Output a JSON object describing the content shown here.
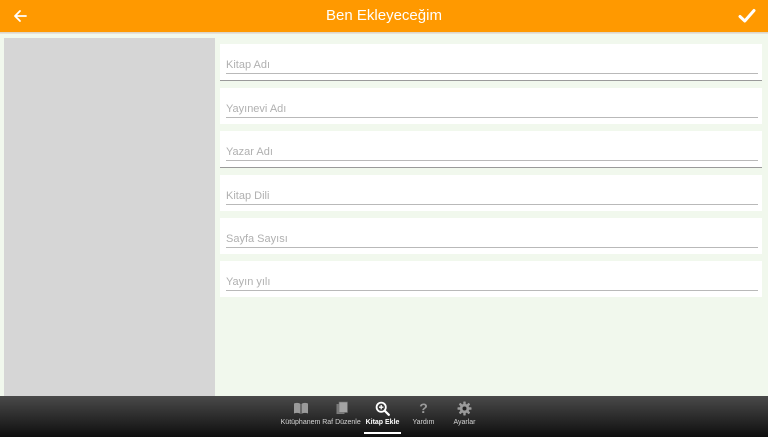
{
  "header": {
    "title": "Ben Ekleyeceğim"
  },
  "form": {
    "fields": [
      {
        "placeholder": "Kitap Adı",
        "value": ""
      },
      {
        "placeholder": "Yayınevi Adı",
        "value": ""
      },
      {
        "placeholder": "Yazar Adı",
        "value": ""
      },
      {
        "placeholder": "Kitap Dili",
        "value": ""
      },
      {
        "placeholder": "Sayfa Sayısı",
        "value": ""
      },
      {
        "placeholder": "Yayın yılı",
        "value": ""
      }
    ]
  },
  "bottom_nav": {
    "items": [
      {
        "label": "Kütüphanem",
        "icon": "open-book-icon"
      },
      {
        "label": "Raf Düzenle",
        "icon": "bookshelf-icon"
      },
      {
        "label": "Kitap Ekle",
        "icon": "search-plus-icon",
        "active": true
      },
      {
        "label": "Yardım",
        "icon": "question-icon"
      },
      {
        "label": "Ayarlar",
        "icon": "gear-icon"
      }
    ]
  },
  "colors": {
    "topbar": "#ff9900",
    "content_background": "#f1f8ed",
    "cover_placeholder": "#d6d6d6",
    "bottom_bar": "#1a1a1a"
  }
}
